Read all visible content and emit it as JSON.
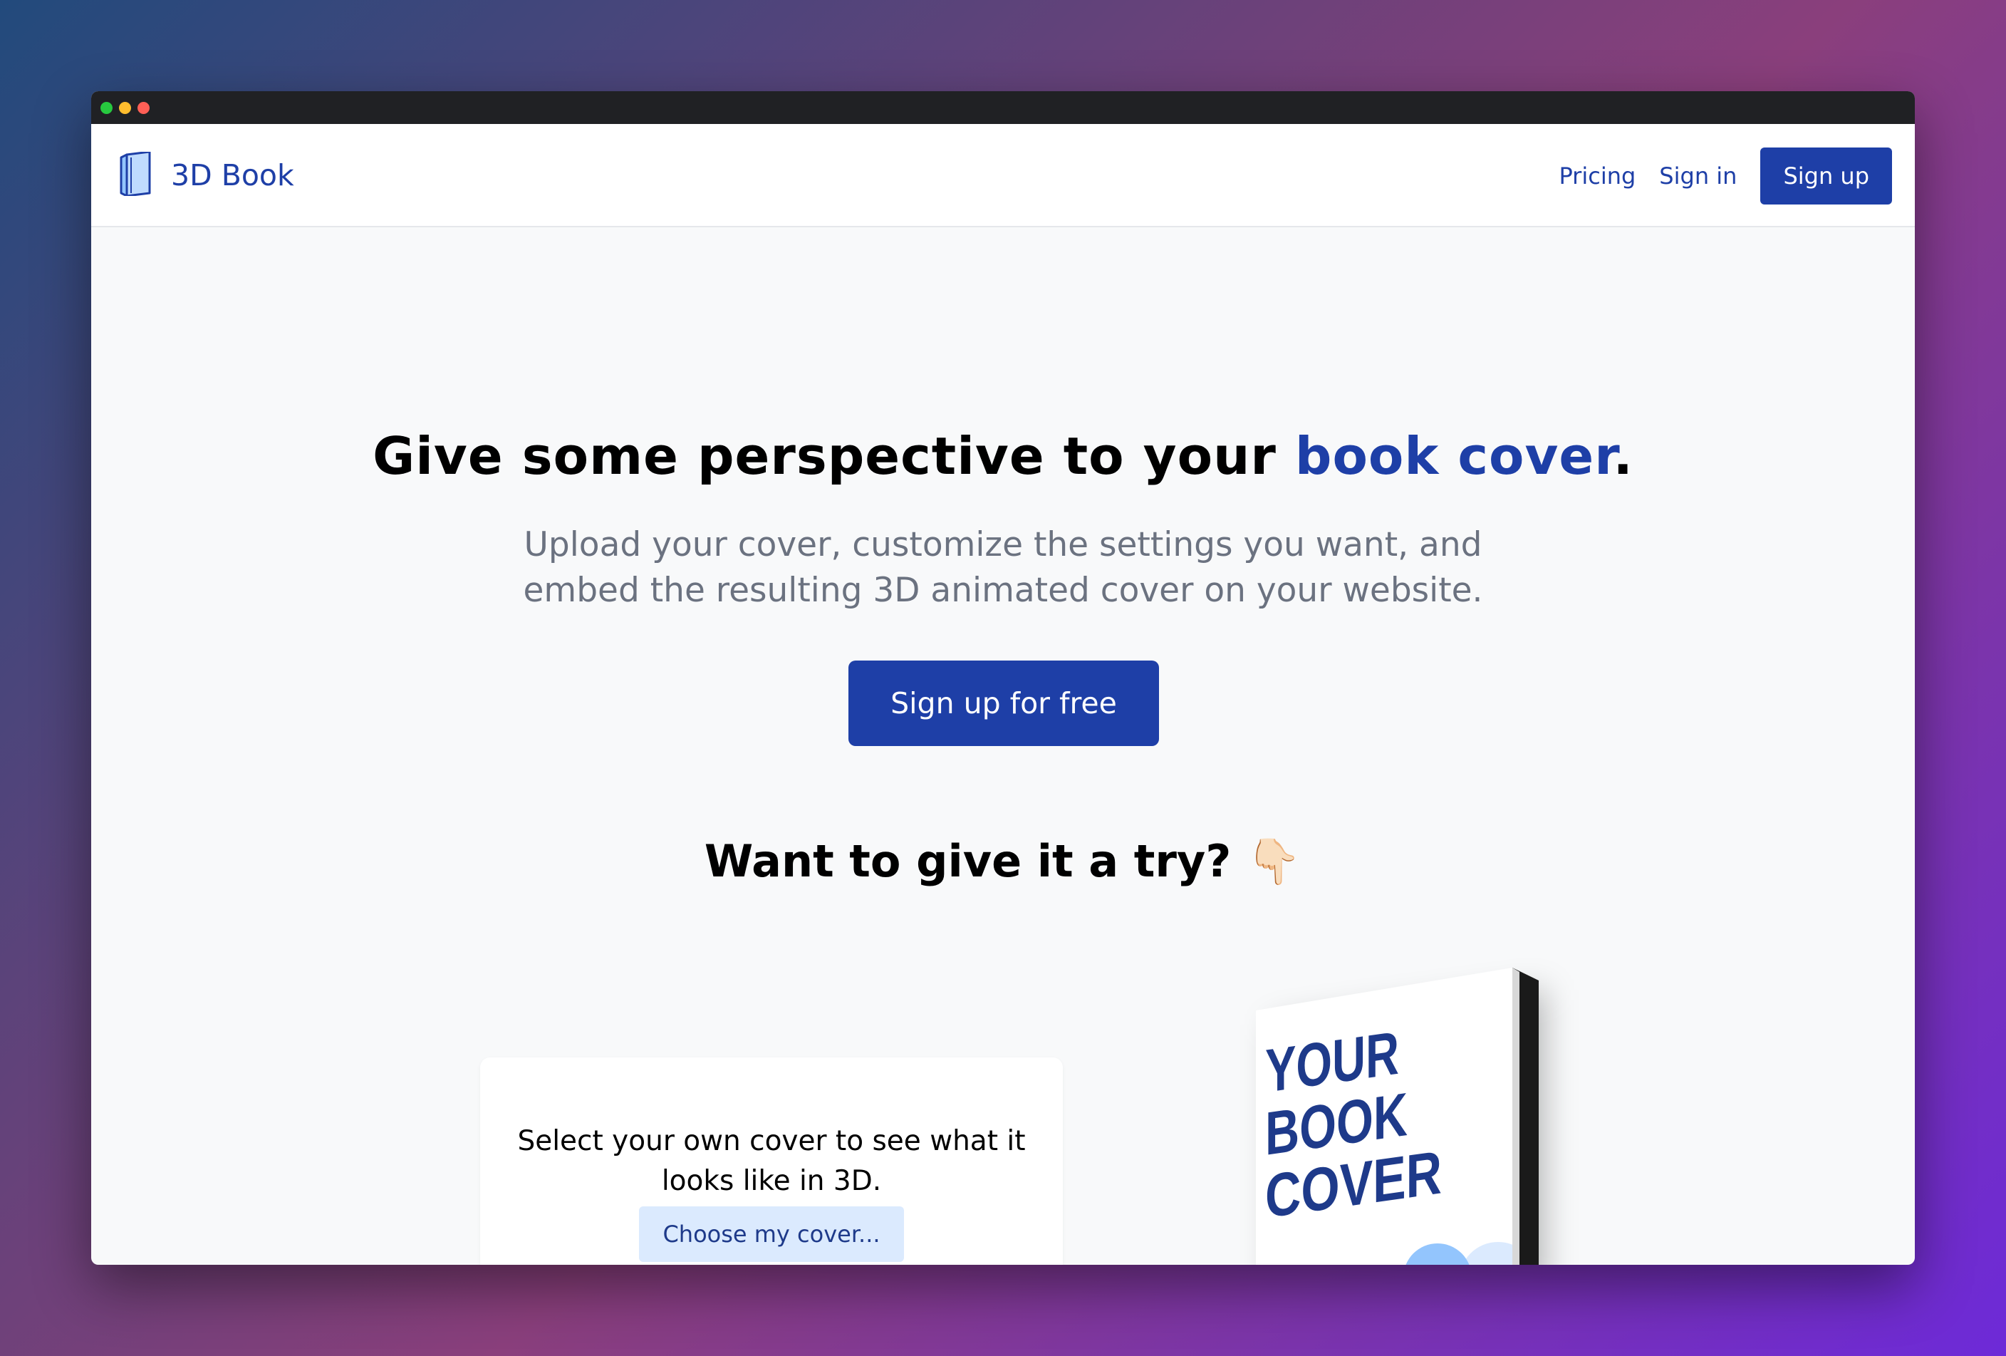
{
  "window": {
    "controls": [
      "close",
      "minimize",
      "maximize"
    ]
  },
  "navbar": {
    "brand": {
      "name": "3D Book",
      "icon": "book-icon"
    },
    "links": {
      "pricing": "Pricing",
      "sign_in": "Sign in"
    },
    "sign_up_label": "Sign up"
  },
  "hero": {
    "title_prefix": "Give some perspective to your ",
    "title_accent": "book cover",
    "title_suffix": ".",
    "subtitle": "Upload your cover, customize the settings you want, and embed the resulting 3D animated cover on your website.",
    "cta_label": "Sign up for free"
  },
  "try_section": {
    "title": "Want to give it a try? 👇🏻",
    "card_text": "Select your own cover to see what it looks like in 3D.",
    "choose_label": "Choose my cover...",
    "book_cover_lines": [
      "YOUR",
      "BOOK",
      "COVER"
    ]
  },
  "colors": {
    "accent": "#1e3fa7",
    "muted_text": "#6b7280",
    "button_light_bg": "#dbeafe",
    "window_bg": "#f8f9fa"
  }
}
